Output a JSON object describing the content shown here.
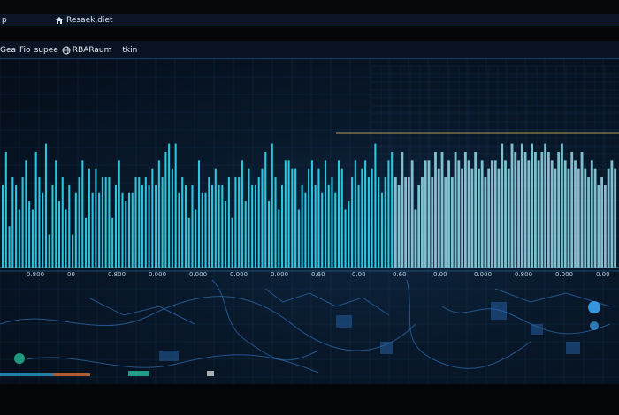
{
  "titlebar": {
    "app_label": "p",
    "title": "Resaek.diet"
  },
  "toolbar": {
    "item1": "Gea",
    "item2": "Fio",
    "item3": "supee",
    "item4": "RBARaum",
    "item5": "tkin"
  },
  "axis": {
    "ticks": [
      "0.800",
      "00",
      "0.800",
      "0.000",
      "0.000",
      "0.000",
      "0.000",
      "0.60",
      "0.00",
      "0.60",
      "0.00",
      "0.000",
      "0.800",
      "0.000",
      "0.00"
    ]
  },
  "colors": {
    "bars": "#2fd6ee",
    "right_bars": "#9fe8f6",
    "accent_line": "#d8b05a",
    "map": "#2f6fb4"
  },
  "icons": {
    "window": "home-icon",
    "toolbar": "globe-icon"
  },
  "chart_data": {
    "type": "bar",
    "x": [],
    "values": [
      20,
      28,
      10,
      22,
      20,
      14,
      22,
      26,
      16,
      14,
      28,
      22,
      18,
      30,
      8,
      20,
      26,
      16,
      22,
      14,
      20,
      8,
      18,
      22,
      26,
      12,
      24,
      18,
      24,
      18,
      22,
      22,
      22,
      12,
      20,
      26,
      18,
      16,
      18,
      18,
      22,
      22,
      20,
      22,
      20,
      24,
      20,
      26,
      22,
      28,
      30,
      24,
      30,
      18,
      22,
      20,
      12,
      20,
      14,
      26,
      18,
      18,
      22,
      20,
      24,
      20,
      20,
      16,
      22,
      12,
      22,
      22,
      26,
      16,
      24,
      20,
      20,
      22,
      24,
      28,
      16,
      30,
      22,
      14,
      20,
      26,
      26,
      24,
      24,
      14,
      20,
      18,
      24,
      26,
      20,
      24,
      18,
      26,
      20,
      22,
      18,
      26,
      24,
      14,
      16,
      22,
      26,
      20,
      24,
      26,
      22,
      24,
      30,
      22,
      18,
      22,
      26,
      28,
      22,
      20,
      28,
      22,
      22,
      26,
      14,
      20,
      22,
      26,
      26,
      22,
      28,
      24,
      28,
      22,
      26,
      22,
      28,
      26,
      24,
      28,
      26,
      24,
      28,
      24,
      26,
      22,
      24,
      26,
      26,
      24,
      30,
      26,
      24,
      30,
      28,
      26,
      30,
      28,
      26,
      30,
      28,
      26,
      28,
      30,
      28,
      26,
      24,
      28,
      30,
      26,
      24,
      28,
      26,
      24,
      28,
      24,
      22,
      26,
      24,
      20,
      22,
      20,
      24,
      26,
      24
    ],
    "title": "",
    "xlabel": "",
    "ylabel": "",
    "grid": true
  }
}
